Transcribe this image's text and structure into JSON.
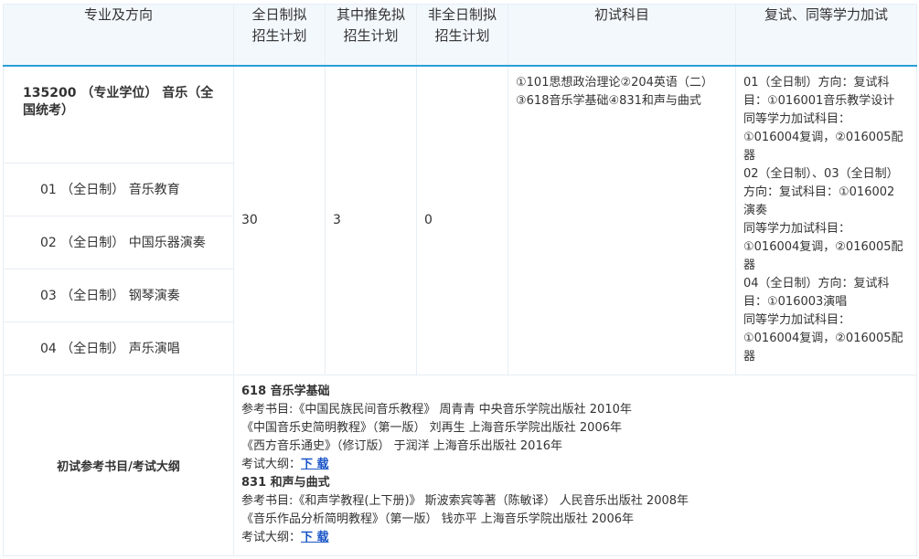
{
  "headers": {
    "major": "专业及方向",
    "full_time_line1": "全日制拟",
    "full_time_line2": "招生计划",
    "recommend_line1": "其中推免拟",
    "recommend_line2": "招生计划",
    "part_time_line1": "非全日制拟",
    "part_time_line2": "招生计划",
    "exam_subjects": "初试科目",
    "retest": "复试、同等学力加试"
  },
  "major": {
    "title": "135200 （专业学位） 音乐（全国统考）",
    "directions": [
      "01 （全日制） 音乐教育",
      "02 （全日制） 中国乐器演奏",
      "03 （全日制） 钢琴演奏",
      "04 （全日制） 声乐演唱"
    ],
    "full_time_plan": "30",
    "recommend_plan": "3",
    "part_time_plan": "0",
    "exam_subjects_lines": [
      "①101思想政治理论②204英语（二）",
      "③618音乐学基础④831和声与曲式"
    ],
    "retest_lines": [
      "01（全日制）方向：复试科",
      "目：①016001音乐教学设计",
      "同等学力加试科目：",
      "①016004复调，②016005配",
      "器",
      "02（全日制）、03（全日制）",
      "方向：复试科目：①016002",
      "演奏",
      "同等学力加试科目：",
      "①016004复调，②016005配",
      "器",
      "04（全日制）方向：复试科",
      "目：①016003演唱",
      "同等学力加试科目：",
      "①016004复调，②016005配",
      "器"
    ]
  },
  "reference": {
    "label": "初试参考书目/考试大纲",
    "sections": [
      {
        "title": "618 音乐学基础",
        "books": [
          "参考书目:《中国民族民间音乐教程》 周青青 中央音乐学院出版社 2010年",
          "《中国音乐史简明教程》（第一版） 刘再生 上海音乐学院出版社 2006年",
          "《西方音乐通史》（修订版） 于润洋 上海音乐出版社 2016年"
        ],
        "outline_label": "考试大纲：",
        "download": "下 载"
      },
      {
        "title": "831 和声与曲式",
        "books": [
          "参考书目:《和声学教程(上下册)》 斯波索宾等著（陈敏译） 人民音乐出版社 2008年",
          "《音乐作品分析简明教程》（第一版） 钱亦平 上海音乐学院出版社 2006年"
        ],
        "outline_label": "考试大纲：",
        "download": "下 载"
      }
    ]
  },
  "colors": {
    "header_bg": "#f3f8fd",
    "header_rule": "#2a9fd6",
    "border": "#e6eef5",
    "link": "#1a55c8"
  }
}
